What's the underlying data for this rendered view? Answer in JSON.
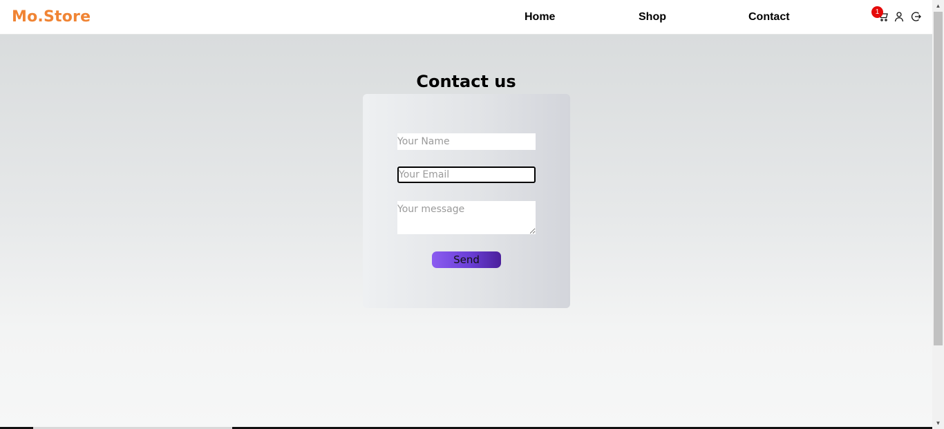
{
  "header": {
    "brand": "Mo.Store",
    "nav": [
      "Home",
      "Shop",
      "Contact"
    ],
    "cart_count": "1",
    "icons": [
      "cart-icon",
      "user-icon",
      "logout-icon"
    ],
    "brand_color": "#f08434"
  },
  "contact": {
    "title": "Contact us",
    "name_placeholder": "Your Name",
    "email_placeholder": "Your Email",
    "message_placeholder": "Your message",
    "send_label": "Send"
  }
}
